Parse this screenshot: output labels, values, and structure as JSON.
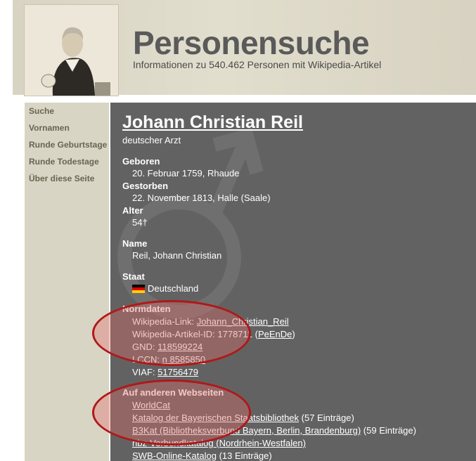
{
  "header": {
    "title": "Personensuche",
    "subtitle": "Informationen zu 540.462 Personen mit Wikipedia-Artikel"
  },
  "sidebar": {
    "items": [
      {
        "label": "Suche"
      },
      {
        "label": "Vornamen"
      },
      {
        "label": "Runde Geburtstage"
      },
      {
        "label": "Runde Todestage"
      },
      {
        "label": "Über diese Seite"
      }
    ]
  },
  "person": {
    "name": "Johann Christian Reil",
    "description": "deutscher Arzt",
    "born_label": "Geboren",
    "born": "20. Februar 1759, Rhaude",
    "died_label": "Gestorben",
    "died": "22. November 1813, Halle (Saale)",
    "age_label": "Alter",
    "age": "54†",
    "name_label": "Name",
    "name_sorted": "Reil, Johann Christian",
    "state_label": "Staat",
    "state": "Deutschland"
  },
  "normdaten": {
    "label": "Normdaten",
    "wiki_link_label": "Wikipedia-Link:",
    "wiki_link": "Johann_Christian_Reil",
    "wiki_id_label": "Wikipedia-Artikel-ID:",
    "wiki_id": "1778711",
    "pendende": "PeEnDe",
    "gnd_label": "GND:",
    "gnd": "118599224",
    "lccn_label": "LCCN:",
    "lccn": "n 8585850",
    "viaf_label": "VIAF:",
    "viaf": "51756479"
  },
  "other_sites": {
    "label": "Auf anderen Webseiten",
    "items": [
      {
        "text": "WorldCat",
        "suffix": ""
      },
      {
        "text": "Katalog der Bayerischen Staatsbibliothek",
        "suffix": " (57 Einträge)"
      },
      {
        "text": "B3Kat (Bibliotheksverbund Bayern, Berlin, Brandenburg)",
        "suffix": " (59 Einträge)"
      },
      {
        "text": "hbz-Verbundkatalog (Nordrhein-Westfalen)",
        "suffix": ""
      },
      {
        "text": "SWB-Online-Katalog",
        "suffix": " (13 Einträge)"
      }
    ]
  },
  "colors": {
    "main_bg": "#626262",
    "sidebar_bg": "#d8d5c4",
    "highlight": "#b01818"
  }
}
